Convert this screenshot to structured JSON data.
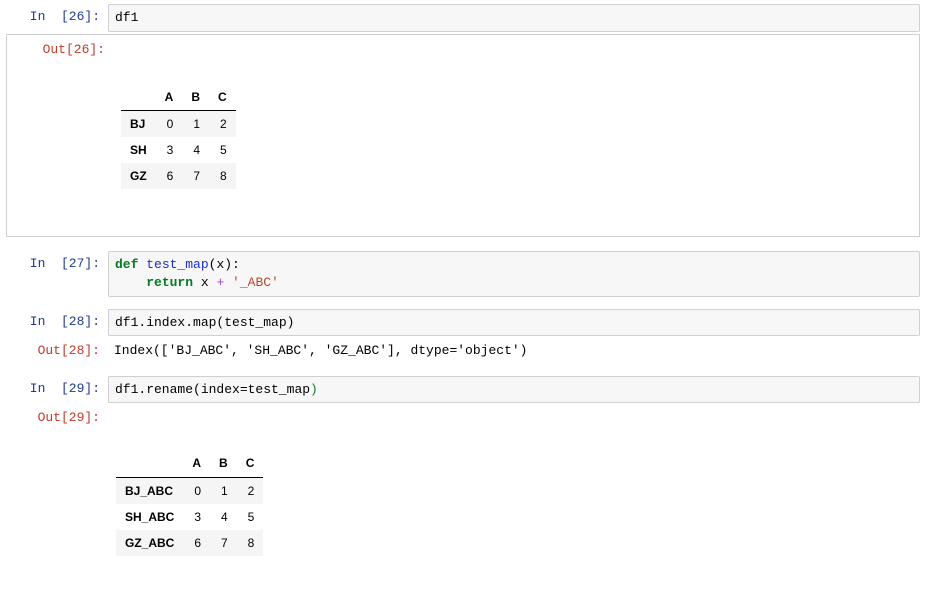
{
  "cells": {
    "c26": {
      "in_prompt": "In  [26]:",
      "out_prompt": "Out[26]:",
      "code_text": "df1",
      "table": {
        "cols": [
          "A",
          "B",
          "C"
        ],
        "rows": [
          {
            "idx": "BJ",
            "vals": [
              "0",
              "1",
              "2"
            ]
          },
          {
            "idx": "SH",
            "vals": [
              "3",
              "4",
              "5"
            ]
          },
          {
            "idx": "GZ",
            "vals": [
              "6",
              "7",
              "8"
            ]
          }
        ]
      }
    },
    "c27": {
      "in_prompt": "In  [27]:",
      "kw_def": "def",
      "fn_name": "test_map",
      "sig_rest": "(x):",
      "kw_return": "return",
      "ret_lhs": " x ",
      "op_plus": "+",
      "ret_str": " '_ABC'"
    },
    "c28": {
      "in_prompt": "In  [28]:",
      "out_prompt": "Out[28]:",
      "code_text": "df1.index.map(test_map)",
      "output_text": "Index(['BJ_ABC', 'SH_ABC', 'GZ_ABC'], dtype='object')"
    },
    "c29": {
      "in_prompt": "In  [29]:",
      "out_prompt": "Out[29]:",
      "code_pre": "df1.rename",
      "code_lpar": "(",
      "code_kwarg": "index=test_map",
      "code_rpar": ")",
      "table": {
        "cols": [
          "A",
          "B",
          "C"
        ],
        "rows": [
          {
            "idx": "BJ_ABC",
            "vals": [
              "0",
              "1",
              "2"
            ]
          },
          {
            "idx": "SH_ABC",
            "vals": [
              "3",
              "4",
              "5"
            ]
          },
          {
            "idx": "GZ_ABC",
            "vals": [
              "6",
              "7",
              "8"
            ]
          }
        ]
      }
    }
  }
}
